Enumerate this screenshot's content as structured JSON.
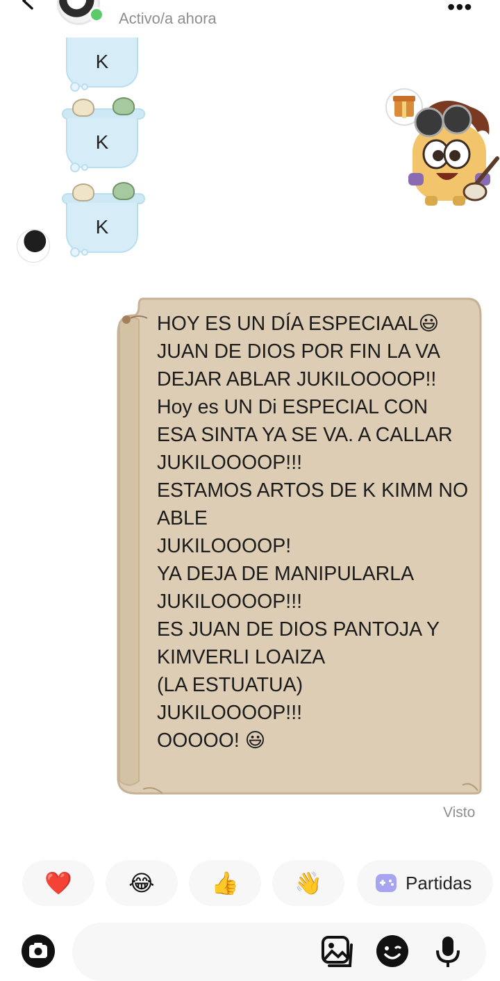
{
  "header": {
    "status": "Activo/a ahora",
    "icons": {
      "back": "chevron-left-icon",
      "more": "more-dots-icon",
      "online": "online-dot"
    }
  },
  "received": {
    "messages": [
      "K",
      "K",
      "K"
    ]
  },
  "sent": {
    "text": "HOY ES UN DÍA ESPECIAAL😃\nJUAN DE DIOS POR FIN LA VA DEJAR ABLAR JUKILOOOOP!!\nHoy es UN Di ESPECIAL CON ESA SINTA YA SE VA. A CALLAR\nJUKILOOOOP!!!\nESTAMOS ARTOS DE K KIMM NO ABLE\nJUKILOOOOP!\nYA DEJA DE MANIPULARLA\nJUKILOOOOP!!!\nES JUAN DE DIOS PANTOJA Y KIMVERLI LOAIZA\n(LA ESTUATUA)\nJUKILOOOOP!!!\nOOOOO! 😃",
    "seen": "Visto"
  },
  "quick_replies": {
    "heart": "❤️",
    "laugh": "😂",
    "thumbs": "👍",
    "wave": "👋",
    "partidas": "Partidas"
  },
  "composer": {
    "icons": [
      "camera-icon",
      "gallery-icon",
      "sticker-icon",
      "microphone-icon"
    ]
  },
  "colors": {
    "bubble_received": "#d6edf8",
    "scroll_paper": "#dccdb4",
    "online": "#5cc96b",
    "muted_text": "#8e8e8e"
  }
}
